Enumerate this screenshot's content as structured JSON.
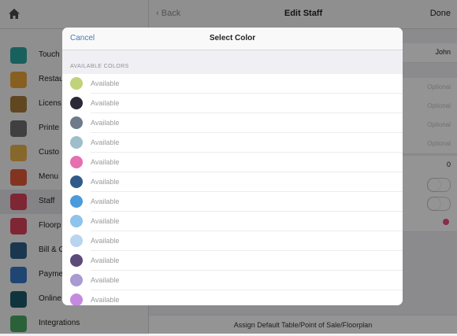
{
  "nav": {
    "back": "Back",
    "title": "Edit Staff",
    "done": "Done"
  },
  "sidebar": {
    "items": [
      {
        "label": "Touch",
        "color": "#2aa6a0",
        "active": false
      },
      {
        "label": "Restau",
        "color": "#e9a63a",
        "active": false
      },
      {
        "label": "Licens",
        "color": "#a57a3c",
        "active": false
      },
      {
        "label": "Printe",
        "color": "#6e6e6e",
        "active": false
      },
      {
        "label": "Custo",
        "color": "#e8b44d",
        "active": false
      },
      {
        "label": "Menu",
        "color": "#e05a3a",
        "active": false
      },
      {
        "label": "Staff",
        "color": "#d9435a",
        "active": true
      },
      {
        "label": "Floorp",
        "color": "#d9435a",
        "active": false
      },
      {
        "label": "Bill & C",
        "color": "#2f5f8a",
        "active": false
      },
      {
        "label": "Payme",
        "color": "#3a78c4",
        "active": false
      },
      {
        "label": "Online",
        "color": "#1d5a6b",
        "active": false
      },
      {
        "label": "Integrations",
        "color": "#49a862",
        "active": false
      }
    ]
  },
  "detail": {
    "name_value": "John",
    "optional_placeholder": "Optional",
    "zero_value": "0",
    "assign_link": "Assign Default Table/Point of Sale/Floorplan"
  },
  "modal": {
    "cancel": "Cancel",
    "title": "Select Color",
    "section_header": "AVAILABLE COLORS",
    "colors": [
      {
        "label": "Available",
        "hex": "#c0d27a"
      },
      {
        "label": "Available",
        "hex": "#2b2838"
      },
      {
        "label": "Available",
        "hex": "#6f7a8a"
      },
      {
        "label": "Available",
        "hex": "#9dbfcb"
      },
      {
        "label": "Available",
        "hex": "#e56fb0"
      },
      {
        "label": "Available",
        "hex": "#2f5a8a"
      },
      {
        "label": "Available",
        "hex": "#4a9bdc"
      },
      {
        "label": "Available",
        "hex": "#8dc3ec"
      },
      {
        "label": "Available",
        "hex": "#b9d4ee"
      },
      {
        "label": "Available",
        "hex": "#5b4a7a"
      },
      {
        "label": "Available",
        "hex": "#a99ad1"
      },
      {
        "label": "Available",
        "hex": "#c58ae0"
      }
    ]
  }
}
